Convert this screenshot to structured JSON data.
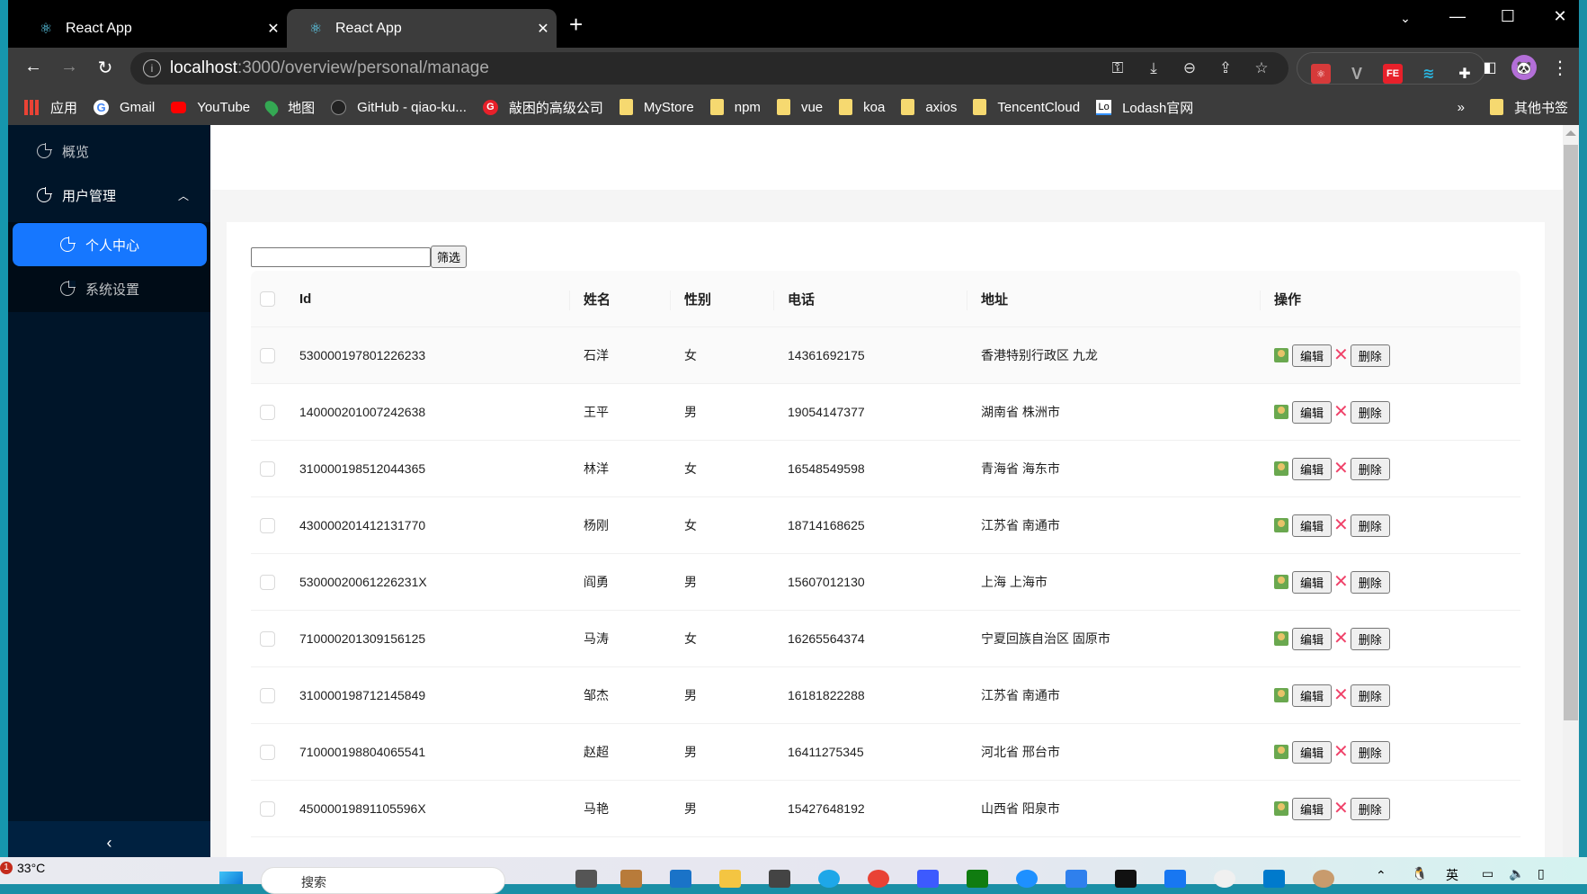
{
  "browser": {
    "tabs": [
      {
        "title": "React App",
        "active": false
      },
      {
        "title": "React App",
        "active": true
      }
    ],
    "new_tab": "+",
    "window_controls": {
      "tab_search": "⌄",
      "minimize": "—",
      "maximize": "☐",
      "close": "✕"
    },
    "url_host": "localhost",
    "url_path": ":3000/overview/personal/manage",
    "bookmarks": [
      {
        "label": "应用",
        "icon": "apps-grid-icon"
      },
      {
        "label": "Gmail",
        "icon": "google-icon"
      },
      {
        "label": "YouTube",
        "icon": "youtube-icon"
      },
      {
        "label": "地图",
        "icon": "maps-pin-icon"
      },
      {
        "label": "GitHub - qiao-ku...",
        "icon": "github-icon"
      },
      {
        "label": "敲困的高级公司",
        "icon": "g-logo-icon"
      },
      {
        "label": "MyStore",
        "icon": "folder-icon"
      },
      {
        "label": "npm",
        "icon": "folder-icon"
      },
      {
        "label": "vue",
        "icon": "folder-icon"
      },
      {
        "label": "koa",
        "icon": "folder-icon"
      },
      {
        "label": "axios",
        "icon": "folder-icon"
      },
      {
        "label": "TencentCloud",
        "icon": "folder-icon"
      },
      {
        "label": "Lodash官网",
        "icon": "lodash-icon"
      }
    ],
    "bookmarks_overflow": "»",
    "other_bookmarks": "其他书签"
  },
  "sidebar": {
    "items": [
      {
        "label": "概览",
        "icon": "pie-chart-icon"
      },
      {
        "label": "用户管理",
        "icon": "pie-chart-icon",
        "expanded": true,
        "children": [
          {
            "label": "个人中心",
            "icon": "pie-chart-icon",
            "active": true
          },
          {
            "label": "系统设置",
            "icon": "pie-chart-icon"
          }
        ]
      }
    ],
    "collapse": "‹"
  },
  "filter": {
    "input_value": "",
    "button_label": "筛选"
  },
  "table": {
    "columns": [
      "Id",
      "姓名",
      "性别",
      "电话",
      "地址",
      "操作"
    ],
    "rows": [
      {
        "id": "530000197801226233",
        "name": "石洋",
        "gender": "女",
        "phone": "14361692175",
        "address": "香港特别行政区 九龙"
      },
      {
        "id": "140000201007242638",
        "name": "王平",
        "gender": "男",
        "phone": "19054147377",
        "address": "湖南省 株洲市"
      },
      {
        "id": "310000198512044365",
        "name": "林洋",
        "gender": "女",
        "phone": "16548549598",
        "address": "青海省 海东市"
      },
      {
        "id": "430000201412131770",
        "name": "杨刚",
        "gender": "女",
        "phone": "18714168625",
        "address": "江苏省 南通市"
      },
      {
        "id": "53000020061226231X",
        "name": "阎勇",
        "gender": "男",
        "phone": "15607012130",
        "address": "上海 上海市"
      },
      {
        "id": "710000201309156125",
        "name": "马涛",
        "gender": "女",
        "phone": "16265564374",
        "address": "宁夏回族自治区 固原市"
      },
      {
        "id": "310000198712145849",
        "name": "邹杰",
        "gender": "男",
        "phone": "16181822288",
        "address": "江苏省 南通市"
      },
      {
        "id": "710000198804065541",
        "name": "赵超",
        "gender": "男",
        "phone": "16411275345",
        "address": "河北省 邢台市"
      },
      {
        "id": "45000019891105596X",
        "name": "马艳",
        "gender": "男",
        "phone": "15427648192",
        "address": "山西省 阳泉市"
      }
    ],
    "actions": {
      "edit": "编辑",
      "delete": "删除",
      "delete_icon": "✕"
    }
  },
  "taskbar": {
    "weather_badge": "1",
    "weather": "33°C",
    "search_placeholder": "搜索",
    "ime": "英"
  },
  "colors": {
    "accent": "#1677ff",
    "sidebar_bg": "#001529",
    "delete_x": "#f0436a"
  }
}
